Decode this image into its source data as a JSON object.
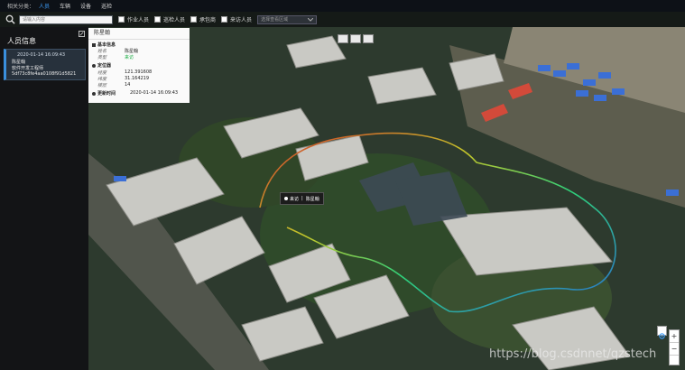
{
  "topbar": {
    "category_label": "相关分类：",
    "tabs": [
      {
        "label": "人员",
        "active": true
      },
      {
        "label": "车辆",
        "active": false
      },
      {
        "label": "设备",
        "active": false
      },
      {
        "label": "巡检",
        "active": false
      }
    ]
  },
  "filter": {
    "search_placeholder": "请输入内容",
    "checkboxes": [
      {
        "label": "作业人员",
        "checked": false
      },
      {
        "label": "巡检人员",
        "checked": false
      },
      {
        "label": "承包商",
        "checked": false
      },
      {
        "label": "来访人员",
        "checked": false
      }
    ],
    "select_placeholder": "选择查看区域"
  },
  "left_panel": {
    "title": "人员信息",
    "card": {
      "time": "2020-01-14 16:09:43",
      "name": "陈星翰",
      "role": "软件开发工程师",
      "id": "5df73c8fe4aa0108f91d5821"
    }
  },
  "popup": {
    "title": "陈星翰",
    "sections": {
      "basic": "基本信息",
      "location": "定位器",
      "updated": "更新时间"
    },
    "fields": {
      "name_label": "姓名",
      "name_value": "陈星翰",
      "type_label": "类型",
      "type_value": "来访",
      "lon_label": "经度",
      "lon_value": "121.391608",
      "lat_label": "纬度",
      "lat_value": "31.164219",
      "floor_label": "楼层",
      "floor_value": "14",
      "updated_value": "2020-01-14 16:09:43"
    }
  },
  "marker": {
    "label": "来访",
    "separator": "|",
    "name": "陈星翰"
  },
  "watermark": "https://blog.csdnnet/qzstech",
  "zoom": {
    "in": "+",
    "out": "−"
  },
  "colors": {
    "accent": "#3ea0ff",
    "status_green": "#22b04a",
    "path_start": "#d1362b",
    "path_end": "#2a6cd6"
  },
  "icons": [
    "search-icon",
    "expand-icon",
    "user-icon",
    "pin-icon",
    "clock-icon",
    "target-icon"
  ]
}
